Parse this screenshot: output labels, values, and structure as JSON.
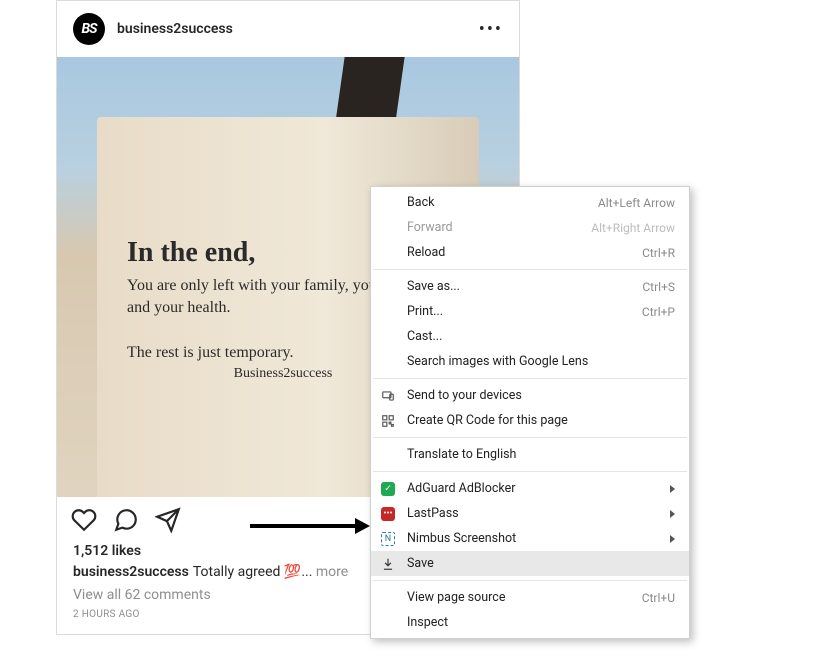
{
  "post": {
    "avatar_text": "BS",
    "username": "business2success",
    "likes": "1,512 likes",
    "caption_username": "business2success",
    "caption_text": "Totally agreed 💯",
    "caption_ellipsis": "...",
    "more_label": "more",
    "view_comments": "View all 62 comments",
    "timestamp": "2 HOURS AGO",
    "book": {
      "title": "In the end,",
      "body": "You are only left with your family, your career and your health.",
      "rest": "The rest is just temporary.",
      "credit": "Business2success"
    }
  },
  "menu": {
    "items": [
      {
        "label": "Back",
        "shortcut": "Alt+Left Arrow",
        "disabled": false
      },
      {
        "label": "Forward",
        "shortcut": "Alt+Right Arrow",
        "disabled": true
      },
      {
        "label": "Reload",
        "shortcut": "Ctrl+R",
        "disabled": false
      }
    ],
    "items2": [
      {
        "label": "Save as...",
        "shortcut": "Ctrl+S"
      },
      {
        "label": "Print...",
        "shortcut": "Ctrl+P"
      },
      {
        "label": "Cast..."
      },
      {
        "label": "Search images with Google Lens"
      }
    ],
    "items3": [
      {
        "label": "Send to your devices",
        "icon": "devices"
      },
      {
        "label": "Create QR Code for this page",
        "icon": "qr"
      }
    ],
    "items4": [
      {
        "label": "Translate to English"
      }
    ],
    "items5": [
      {
        "label": "AdGuard AdBlocker",
        "icon": "adguard",
        "submenu": true
      },
      {
        "label": "LastPass",
        "icon": "lastpass",
        "submenu": true
      },
      {
        "label": "Nimbus Screenshot",
        "icon": "nimbus",
        "submenu": true
      },
      {
        "label": "Save",
        "icon": "download",
        "highlight": true
      }
    ],
    "items6": [
      {
        "label": "View page source",
        "shortcut": "Ctrl+U"
      },
      {
        "label": "Inspect"
      }
    ]
  }
}
